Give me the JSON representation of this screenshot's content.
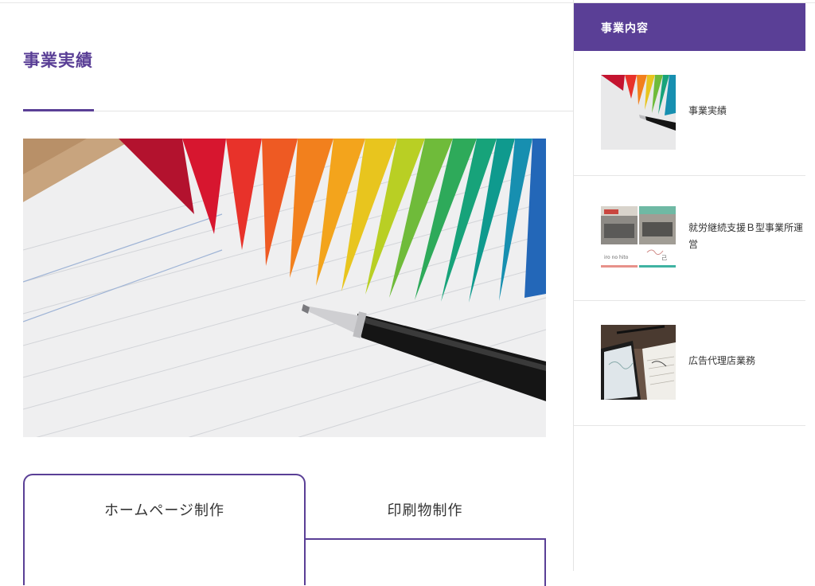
{
  "main": {
    "page_title": "事業実績"
  },
  "tabs": [
    {
      "label": "ホームページ制作",
      "active": true
    },
    {
      "label": "印刷物制作",
      "active": false
    }
  ],
  "sidebar": {
    "heading": "事業内容",
    "items": [
      {
        "label": "事業実績",
        "thumb": "color-swatch-fan-photo"
      },
      {
        "label": "就労継続支援Ｂ型事業所運営",
        "thumb": "office-building-photos"
      },
      {
        "label": "広告代理店業務",
        "thumb": "tablet-and-notebook-photo"
      }
    ]
  },
  "colors": {
    "accent": "#5a3f96",
    "text": "#333333",
    "divider": "#e3e3e3"
  }
}
